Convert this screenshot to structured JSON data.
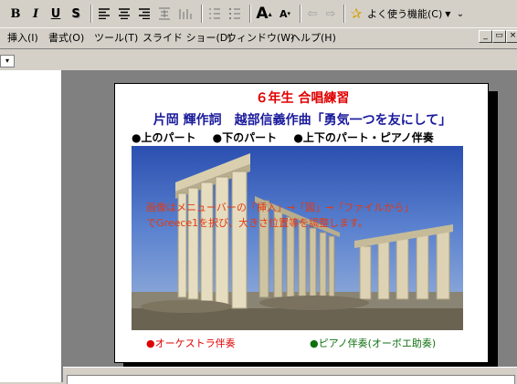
{
  "toolbar": {
    "bold": "B",
    "italic": "I",
    "underline": "U",
    "shadow": "S",
    "favorites_label": "よく使う機能(C)"
  },
  "menubar": {
    "items": [
      "挿入(I)",
      "書式(O)",
      "ツール(T)",
      "スライド ショー(D)",
      "ウィンドウ(W)",
      "ヘルプ(H)"
    ]
  },
  "slide": {
    "title": "６年生 合唱練習",
    "subtitle": "片岡 輝作詞　越部信義作曲「勇気一つを友にして」",
    "parts": [
      "●上のパート",
      "●下のパート",
      "●上下のパート・ピアノ伴奏"
    ],
    "note": "画像はメニューバーの「挿入」→「図」→「ファイルから」でGreece1を択び、大きさ位置等を調整します。",
    "bottom_left": "●オーケストラ伴奏",
    "bottom_right": "●ピアノ伴奏(オーボエ助奏)"
  },
  "colors": {
    "title": "#e00000",
    "subtitle": "#1a1a9c",
    "note": "#e23a12",
    "bottom_right": "#107010"
  }
}
